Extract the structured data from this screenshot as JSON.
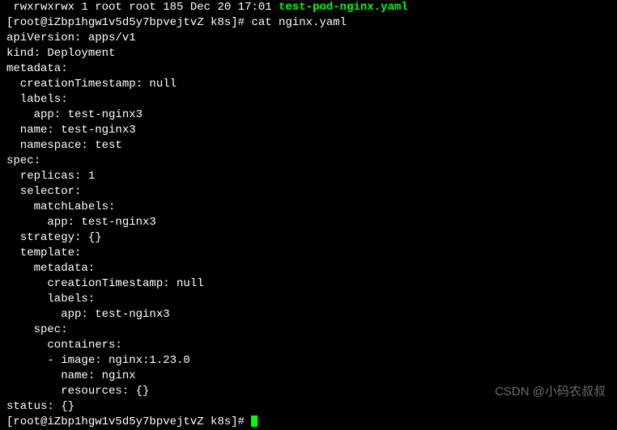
{
  "lines": {
    "l0a": " rwxrwxrwx 1 root root 185 Dec 20 17:01 ",
    "l0b": "test-pod-nginx.yaml",
    "l1": "[root@iZbp1hgw1v5d5y7bpvejtvZ k8s]# cat nginx.yaml",
    "l2": "apiVersion: apps/v1",
    "l3": "kind: Deployment",
    "l4": "metadata:",
    "l5": "  creationTimestamp: null",
    "l6": "  labels:",
    "l7": "    app: test-nginx3",
    "l8": "  name: test-nginx3",
    "l9": "  namespace: test",
    "l10": "spec:",
    "l11": "  replicas: 1",
    "l12": "  selector:",
    "l13": "    matchLabels:",
    "l14": "      app: test-nginx3",
    "l15": "  strategy: {}",
    "l16": "  template:",
    "l17": "    metadata:",
    "l18": "      creationTimestamp: null",
    "l19": "      labels:",
    "l20": "        app: test-nginx3",
    "l21": "    spec:",
    "l22": "      containers:",
    "l23": "      - image: nginx:1.23.0",
    "l24": "        name: nginx",
    "l25": "        resources: {}",
    "l26": "status: {}",
    "l27": "[root@iZbp1hgw1v5d5y7bpvejtvZ k8s]# "
  },
  "watermark": "CSDN @小码农叔叔"
}
